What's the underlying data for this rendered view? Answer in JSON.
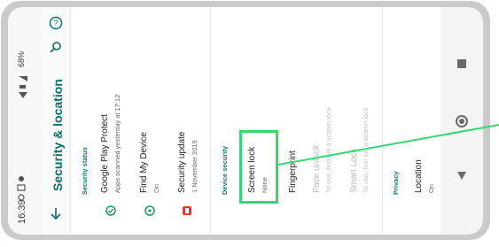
{
  "status_bar": {
    "time": "16:39",
    "battery": "68%"
  },
  "toolbar": {
    "title": "Security & location"
  },
  "sections": {
    "security_status": "Security status",
    "device_security": "Device security",
    "privacy": "Privacy"
  },
  "items": {
    "play_protect": {
      "title": "Google Play Protect",
      "subtitle": "Apps scanned yesterday at 17:12"
    },
    "find_device": {
      "title": "Find My Device",
      "subtitle": "On"
    },
    "security_update": {
      "title": "Security update",
      "subtitle": "1 November 2019"
    },
    "screen_lock": {
      "title": "Screen lock",
      "subtitle": "None"
    },
    "fingerprint": {
      "title": "Fingerprint"
    },
    "face_unlock": {
      "title": "Face unlock",
      "subtitle": "To use, first set a screen lock"
    },
    "smart_lock": {
      "title": "Smart Lock",
      "subtitle": "To use, first set a screen lock"
    },
    "location": {
      "title": "Location",
      "subtitle": "On"
    }
  },
  "icons": {
    "back": "back-arrow-icon",
    "search": "search-icon",
    "help": "help-icon",
    "nav_recents": "recents-square-icon",
    "nav_home": "home-circle-icon",
    "nav_back": "back-triangle-icon"
  },
  "colors": {
    "accent": "#0a6e63",
    "highlight": "#35d772",
    "frame": "#c9cacb",
    "update_icon": "#e53935"
  }
}
